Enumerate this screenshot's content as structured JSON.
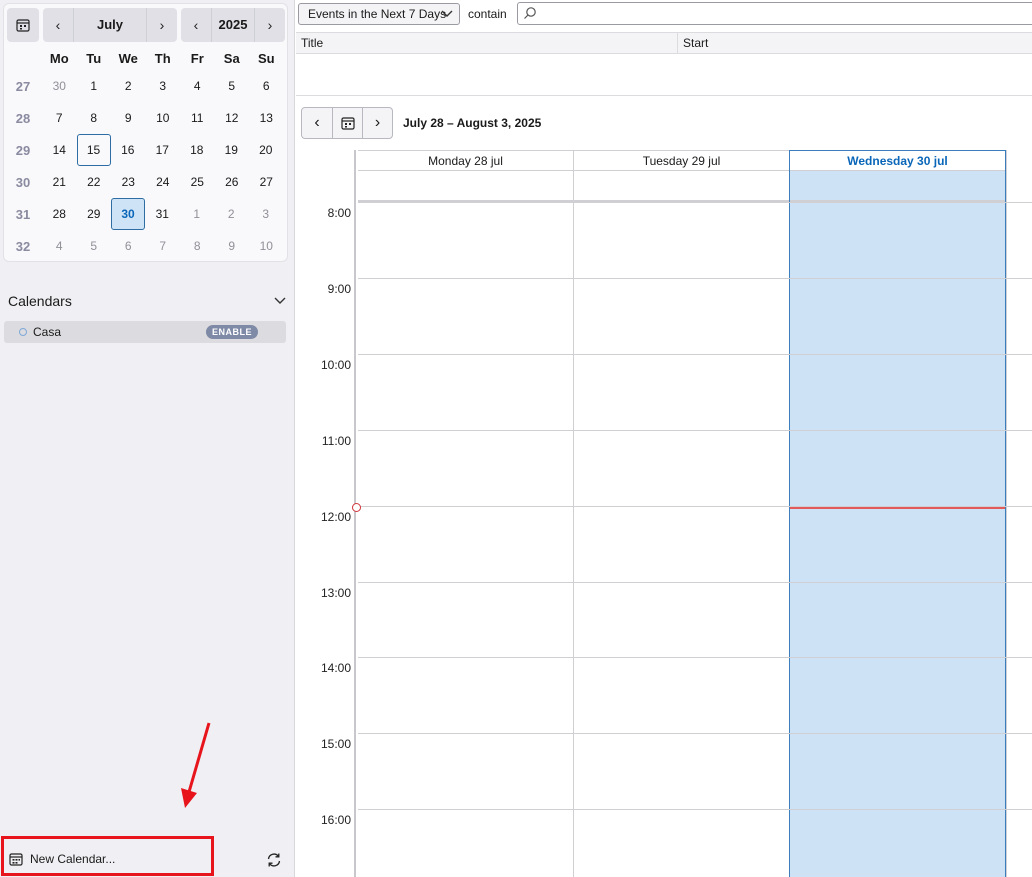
{
  "minimonth": {
    "month": "July",
    "year": "2025",
    "day_names": [
      "Mo",
      "Tu",
      "We",
      "Th",
      "Fr",
      "Sa",
      "Su"
    ],
    "weeks": [
      {
        "wk": "27",
        "days": [
          "30",
          "1",
          "2",
          "3",
          "4",
          "5",
          "6"
        ]
      },
      {
        "wk": "28",
        "days": [
          "7",
          "8",
          "9",
          "10",
          "11",
          "12",
          "13"
        ]
      },
      {
        "wk": "29",
        "days": [
          "14",
          "15",
          "16",
          "17",
          "18",
          "19",
          "20"
        ]
      },
      {
        "wk": "30",
        "days": [
          "21",
          "22",
          "23",
          "24",
          "25",
          "26",
          "27"
        ]
      },
      {
        "wk": "31",
        "days": [
          "28",
          "29",
          "30",
          "31",
          "1",
          "2",
          "3"
        ]
      },
      {
        "wk": "32",
        "days": [
          "4",
          "5",
          "6",
          "7",
          "8",
          "9",
          "10"
        ]
      }
    ]
  },
  "calendars": {
    "title": "Calendars",
    "items": [
      {
        "name": "Casa",
        "badge": "ENABLE"
      }
    ]
  },
  "sidebar_footer": {
    "new_calendar_label": "New Calendar..."
  },
  "filter": {
    "selected": "Events in the Next 7 Days",
    "contain_label": "contain",
    "search_value": ""
  },
  "list_columns": {
    "title": "Title",
    "start": "Start"
  },
  "week_view": {
    "range_label": "July 28 – August 3, 2025",
    "days": [
      {
        "label": "Monday 28 jul",
        "today": false
      },
      {
        "label": "Tuesday 29 jul",
        "today": false
      },
      {
        "label": "Wednesday 30 jul",
        "today": true
      }
    ],
    "hours": [
      "8:00",
      "9:00",
      "10:00",
      "11:00",
      "12:00",
      "13:00",
      "14:00",
      "15:00",
      "16:00"
    ]
  },
  "colors": {
    "accent": "#0a66b8",
    "today_bg": "#cde3f5",
    "now_line": "#e25a5a",
    "highlight_annotation": "#e8141c"
  }
}
